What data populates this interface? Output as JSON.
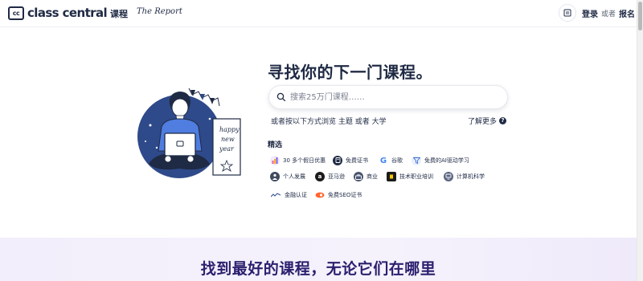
{
  "header": {
    "logo_mark": "cc",
    "logo_text": "class central",
    "nav": {
      "courses": "课程",
      "report": "The Report"
    },
    "login": "登录",
    "or": "或者",
    "signup": "报名"
  },
  "hero": {
    "title": "寻找你的下一门课程。",
    "search_placeholder": "搜索25万门课程……",
    "browse_prefix": "或者按以下方式浏览",
    "browse_subject": "主题",
    "browse_or": "或者",
    "browse_university": "大学",
    "learn_more": "了解更多",
    "featured_label": "精选",
    "illustration_sign": [
      "happy",
      "new",
      "year"
    ]
  },
  "featured": [
    {
      "label": "30 多个假日优惠",
      "icon": "bar-chart-icon",
      "color": "#f0eafc"
    },
    {
      "label": "免费证书",
      "icon": "certificate-icon",
      "color": "#1f2a44"
    },
    {
      "label": "谷歌",
      "icon": "google-icon",
      "color": "#4285f4"
    },
    {
      "label": "免费的AI驱动学习",
      "icon": "ai-filter-icon",
      "color": "#e9effb"
    },
    {
      "label": "个人发展",
      "icon": "person-icon",
      "color": "#3f4a60"
    },
    {
      "label": "亚马逊",
      "icon": "amazon-icon",
      "color": "#1b1b1b"
    },
    {
      "label": "商业",
      "icon": "briefcase-icon",
      "color": "#4a5670"
    },
    {
      "label": "技术职业培训",
      "icon": "tech-icon",
      "color": "#1b1b1b"
    },
    {
      "label": "计算机科学",
      "icon": "computer-icon",
      "color": "#5a6680"
    },
    {
      "label": "金融认证",
      "icon": "finance-icon",
      "color": "#ffffff"
    },
    {
      "label": "免费SEO证书",
      "icon": "semrush-icon",
      "color": "#ff642d"
    }
  ],
  "band": {
    "title": "找到最好的课程，无论它们在哪里"
  }
}
